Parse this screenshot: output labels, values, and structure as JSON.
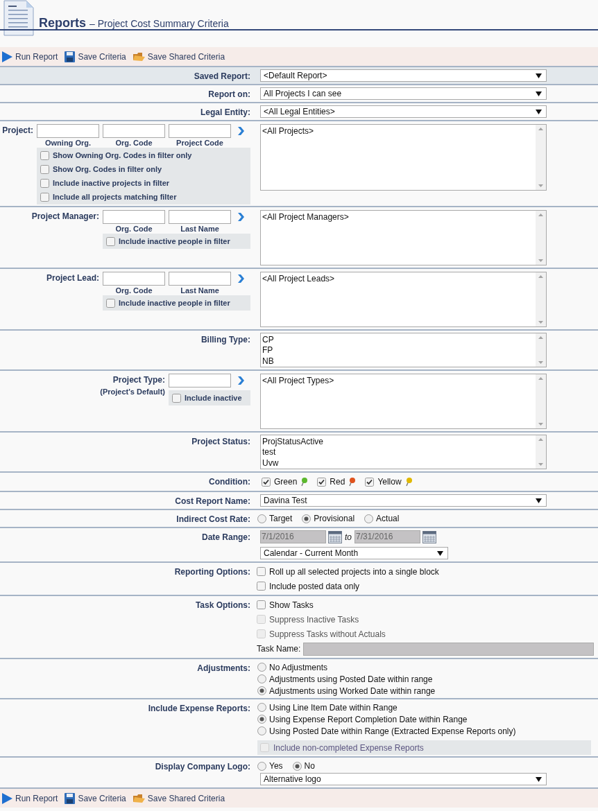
{
  "header": {
    "title": "Reports",
    "subtitle": "– Project Cost Summary Criteria"
  },
  "toolbar_top": [
    {
      "kind": "run",
      "label": "Run Report"
    },
    {
      "kind": "save",
      "label": "Save Criteria"
    },
    {
      "kind": "shared",
      "label": "Save Shared Criteria"
    }
  ],
  "rows": [
    {
      "kind": "select",
      "label": "Saved Report:",
      "value": "<Default Report>",
      "shaded": true
    },
    {
      "kind": "select",
      "label": "Report on:",
      "value": "All Projects I can see",
      "shaded": false
    },
    {
      "kind": "select",
      "label": "Legal Entity:",
      "value": "<All Legal Entities>",
      "shaded": false
    },
    {
      "kind": "filter",
      "label": "Project:",
      "fields": [
        {
          "caption": "Owning Org."
        },
        {
          "caption": "Org. Code"
        },
        {
          "caption": "Project Code"
        }
      ],
      "options": [
        {
          "label": "Show Owning Org. Codes in filter only",
          "checked": false
        },
        {
          "label": "Show Org. Codes in filter only",
          "checked": false
        },
        {
          "label": "Include inactive projects in filter",
          "checked": false
        },
        {
          "label": "Include all projects matching filter",
          "checked": false
        }
      ],
      "list": [
        "<All Projects>"
      ]
    },
    {
      "kind": "filter",
      "label": "Project Manager:",
      "fields": [
        {
          "caption": "Org. Code"
        },
        {
          "caption": "Last Name"
        }
      ],
      "options": [
        {
          "label": "Include inactive people in filter",
          "checked": false
        }
      ],
      "list": [
        "<All Project Managers>"
      ]
    },
    {
      "kind": "filter",
      "label": "Project Lead:",
      "fields": [
        {
          "caption": "Org. Code"
        },
        {
          "caption": "Last Name"
        }
      ],
      "options": [
        {
          "label": "Include inactive people in filter",
          "checked": false
        }
      ],
      "list": [
        "<All Project Leads>"
      ]
    },
    {
      "kind": "list",
      "label": "Billing Type:",
      "list": [
        "CP",
        "FP",
        "NB"
      ]
    },
    {
      "kind": "filter",
      "label": "Project Type:",
      "sublabel": "(Project's Default)",
      "fields": [
        {
          "kind": "plain"
        }
      ],
      "options": [
        {
          "label": "Include inactive",
          "checked": false
        }
      ],
      "list": [
        "<All Project Types>"
      ]
    },
    {
      "kind": "list",
      "label": "Project Status:",
      "list": [
        "ProjStatusActive",
        "test",
        "Uvw"
      ]
    },
    {
      "kind": "condition",
      "label": "Condition:",
      "options": [
        {
          "label": "Green",
          "checked": true,
          "color": "#5cb82e"
        },
        {
          "label": "Red",
          "checked": true,
          "color": "#e0531e"
        },
        {
          "label": "Yellow",
          "checked": true,
          "color": "#e0b800"
        }
      ]
    },
    {
      "kind": "select",
      "label": "Cost Report Name:",
      "value": "Davina Test",
      "shaded": false
    },
    {
      "kind": "radios",
      "label": "Indirect Cost Rate:",
      "inline": true,
      "options": [
        {
          "label": "Target",
          "selected": false
        },
        {
          "label": "Provisional",
          "selected": true
        },
        {
          "label": "Actual",
          "selected": false
        }
      ]
    },
    {
      "kind": "date_range",
      "label": "Date Range:",
      "from": "7/1/2016",
      "separator": "to",
      "to": "7/31/2016",
      "preset": "Calendar - Current Month"
    },
    {
      "kind": "checks",
      "label": "Reporting Options:",
      "options": [
        {
          "label": "Roll up all selected projects into a single block",
          "checked": false,
          "disabled": false
        },
        {
          "label": "Include posted data only",
          "checked": false,
          "disabled": false
        }
      ]
    },
    {
      "kind": "checks",
      "label": "Task Options:",
      "options": [
        {
          "label": "Show Tasks",
          "checked": false,
          "disabled": false
        },
        {
          "label": "Suppress Inactive Tasks",
          "checked": false,
          "disabled": true
        },
        {
          "label": "Suppress Tasks without Actuals",
          "checked": false,
          "disabled": true
        }
      ],
      "task_name": {
        "label": "Task Name:",
        "disabled": true
      }
    },
    {
      "kind": "radios",
      "label": "Adjustments:",
      "inline": false,
      "options": [
        {
          "label": "No Adjustments",
          "selected": false
        },
        {
          "label": "Adjustments using Posted Date within range",
          "selected": false
        },
        {
          "label": "Adjustments using Worked Date within range",
          "selected": true
        }
      ]
    },
    {
      "kind": "radios",
      "label": "Include Expense Reports:",
      "inline": false,
      "options": [
        {
          "label": "Using Line Item Date within Range",
          "selected": false
        },
        {
          "label": "Using Expense Report Completion Date within Range",
          "selected": true
        },
        {
          "label": "Using Posted Date within Range (Extracted Expense Reports only)",
          "selected": false
        }
      ],
      "panel_option": {
        "label": "Include non-completed Expense Reports",
        "checked": false,
        "disabled": true
      }
    },
    {
      "kind": "radios",
      "label": "Display Company Logo:",
      "inline": true,
      "options": [
        {
          "label": "Yes",
          "selected": false
        },
        {
          "label": "No",
          "selected": true
        }
      ],
      "select": "Alternative logo"
    }
  ],
  "toolbar_bottom": [
    {
      "kind": "run",
      "label": "Run Report"
    },
    {
      "kind": "save",
      "label": "Save Criteria"
    },
    {
      "kind": "shared",
      "label": "Save Shared Criteria"
    }
  ]
}
